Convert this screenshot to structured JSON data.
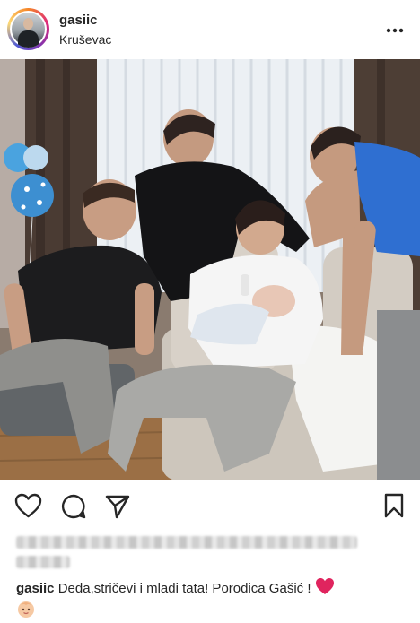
{
  "post": {
    "username": "gasiic",
    "location": "Kruševac",
    "more_icon": "more-dots-icon",
    "caption_user": "gasiic",
    "caption_text": "Deda,stričevi i mladi tata! Porodica Gašić !",
    "caption_emojis": [
      "red-heart",
      "baby-face"
    ]
  },
  "actions": {
    "icons": [
      "heart-icon",
      "comment-icon",
      "share-icon",
      "bookmark-icon"
    ]
  },
  "colors": {
    "text": "#262626",
    "heart_emoji": "#e0245e",
    "story_ring": [
      "#f58529",
      "#dd2a7b",
      "#8134af",
      "#515bd4"
    ]
  }
}
